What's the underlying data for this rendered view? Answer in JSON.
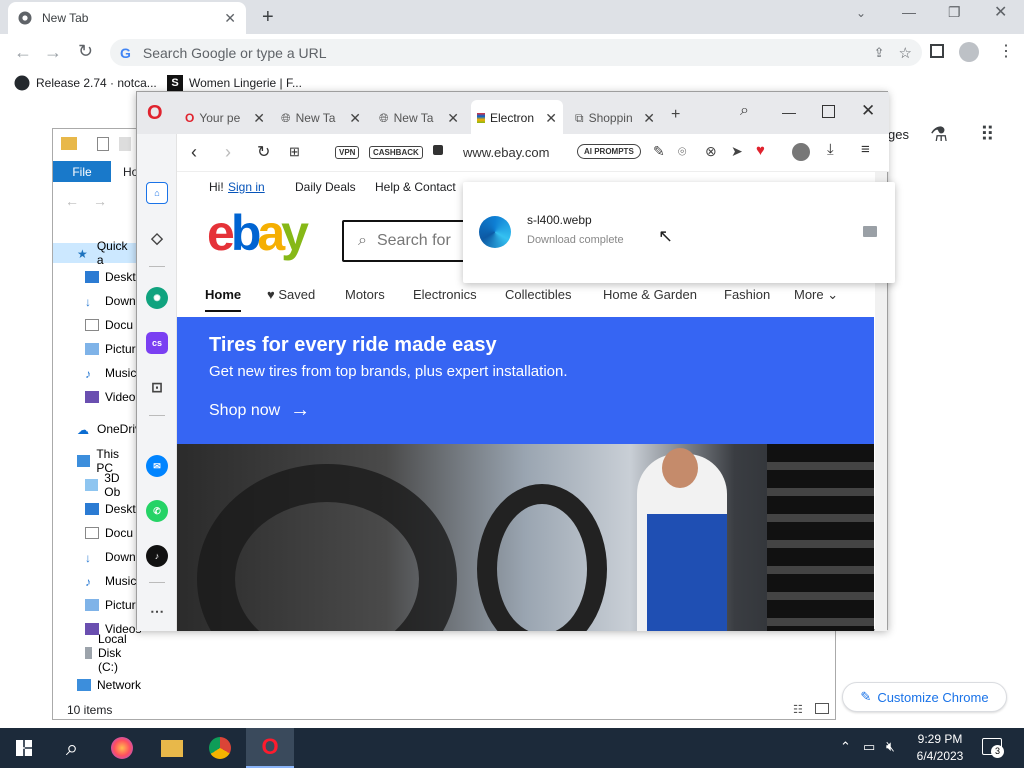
{
  "chrome": {
    "tab_title": "New Tab",
    "omnibox_placeholder": "Search Google or type a URL",
    "bookmarks": [
      {
        "label": "Release 2.74 · notca..."
      },
      {
        "label": "Women Lingerie | F..."
      }
    ],
    "ntp_labels_partial": "ges",
    "customize_label": "Customize Chrome"
  },
  "explorer": {
    "ribbon_file": "File",
    "ribbon_home": "Ho",
    "nav": [
      {
        "label": "Quick a",
        "icon": "star-icon"
      },
      {
        "label": "Deskto",
        "icon": "desktop-icon"
      },
      {
        "label": "Down",
        "icon": "download-icon"
      },
      {
        "label": "Docu",
        "icon": "documents-icon"
      },
      {
        "label": "Pictur",
        "icon": "pictures-icon"
      },
      {
        "label": "Music",
        "icon": "music-icon"
      },
      {
        "label": "Video",
        "icon": "videos-icon"
      },
      {
        "label": "OneDriv",
        "icon": "onedrive-icon"
      },
      {
        "label": "This PC",
        "icon": "this-pc-icon"
      },
      {
        "label": "3D Ob",
        "icon": "3d-objects-icon"
      },
      {
        "label": "Deskto",
        "icon": "desktop-icon"
      },
      {
        "label": "Docu",
        "icon": "documents-icon"
      },
      {
        "label": "Down",
        "icon": "download-icon"
      },
      {
        "label": "Music",
        "icon": "music-icon"
      },
      {
        "label": "Pictur",
        "icon": "pictures-icon"
      },
      {
        "label": "Videos",
        "icon": "videos-icon"
      },
      {
        "label": "Local Disk (C:)",
        "icon": "drive-icon"
      },
      {
        "label": "Network",
        "icon": "network-icon"
      }
    ],
    "status": "10 items"
  },
  "opera": {
    "tabs": [
      {
        "label": "Your pe",
        "icon": "opera-icon"
      },
      {
        "label": "New Ta",
        "icon": "globe-icon"
      },
      {
        "label": "New Ta",
        "icon": "globe-icon"
      },
      {
        "label": "Electron",
        "icon": "ebay-icon",
        "active": true
      },
      {
        "label": "Shoppin",
        "icon": "shopping-icon"
      }
    ],
    "address": "www.ebay.com",
    "vpn": "VPN",
    "cashback": "CASHBACK",
    "ai_prompts": "AI PROMPTS"
  },
  "ebay": {
    "greeting": "Hi!",
    "signin": "Sign in",
    "daily_deals": "Daily Deals",
    "help": "Help & Contact",
    "search_placeholder": "Search for",
    "nav": [
      "Home",
      "Saved",
      "Motors",
      "Electronics",
      "Collectibles",
      "Home & Garden",
      "Fashion",
      "More"
    ],
    "hero_title": "Tires for every ride made easy",
    "hero_sub": "Get new tires from top brands, plus expert installation.",
    "hero_cta": "Shop now"
  },
  "download": {
    "filename": "s-l400.webp",
    "status": "Download complete"
  },
  "taskbar": {
    "time": "9:29 PM",
    "date": "6/4/2023",
    "notif_count": "3"
  }
}
